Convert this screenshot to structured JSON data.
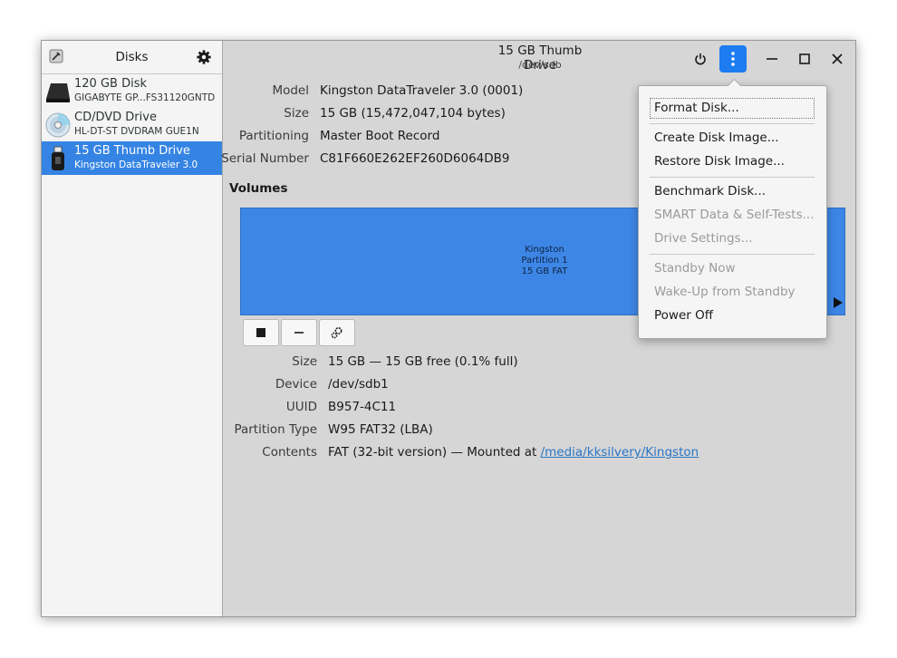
{
  "sidebar": {
    "title": "Disks",
    "drives": [
      {
        "name": "120 GB Disk",
        "model": "GIGABYTE GP...FS31120GNTD",
        "icon": "hard-disk-icon"
      },
      {
        "name": "CD/DVD Drive",
        "model": "HL-DT-ST DVDRAM GUE1N",
        "icon": "optical-disc-icon"
      },
      {
        "name": "15 GB Thumb Drive",
        "model": "Kingston DataTraveler 3.0",
        "icon": "usb-drive-icon",
        "selected": true
      }
    ]
  },
  "header": {
    "title": "15 GB Thumb Drive",
    "subtitle": "/dev/sdb"
  },
  "drive_props": [
    {
      "label": "Model",
      "value": "Kingston DataTraveler 3.0 (0001)"
    },
    {
      "label": "Size",
      "value": "15 GB (15,472,047,104 bytes)"
    },
    {
      "label": "Partitioning",
      "value": "Master Boot Record"
    },
    {
      "label": "Serial Number",
      "value": "C81F660E262EF260D6064DB9"
    }
  ],
  "volumes": {
    "heading": "Volumes",
    "partition": {
      "line1": "Kingston",
      "line2": "Partition 1",
      "line3": "15 GB FAT"
    }
  },
  "volume_props": [
    {
      "label": "Size",
      "value": "15 GB — 15 GB free (0.1% full)"
    },
    {
      "label": "Device",
      "value": "/dev/sdb1"
    },
    {
      "label": "UUID",
      "value": "B957-4C11"
    },
    {
      "label": "Partition Type",
      "value": "W95 FAT32 (LBA)"
    },
    {
      "label": "Contents",
      "value": "FAT (32-bit version) — Mounted at ",
      "link": "/media/kksilvery/Kingston"
    }
  ],
  "menu": {
    "items": [
      {
        "label": "Format Disk...",
        "enabled": true
      },
      {
        "label": "Create Disk Image...",
        "enabled": true
      },
      {
        "label": "Restore Disk Image...",
        "enabled": true
      },
      {
        "label": "Benchmark Disk...",
        "enabled": true
      },
      {
        "label": "SMART Data & Self-Tests...",
        "enabled": false
      },
      {
        "label": "Drive Settings...",
        "enabled": false
      },
      {
        "label": "Standby Now",
        "enabled": false
      },
      {
        "label": "Wake-Up from Standby",
        "enabled": false
      },
      {
        "label": "Power Off",
        "enabled": true
      }
    ]
  },
  "colors": {
    "accent": "#3584e4",
    "menu_button": "#1c7cf0",
    "partition": "#3d86e6"
  }
}
